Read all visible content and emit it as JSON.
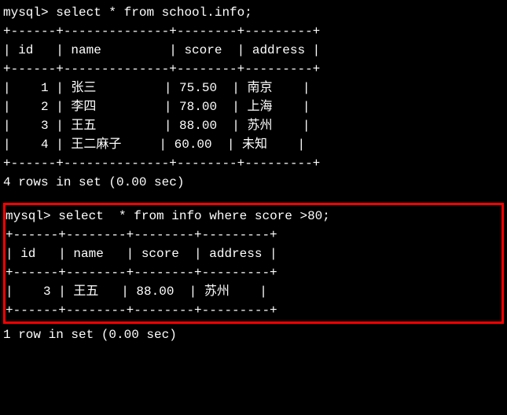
{
  "query1": {
    "prompt": "mysql> ",
    "sql": "select * from school.info;",
    "border_top": "+------+--------------+--------+---------+",
    "header_line": "| id   | name         | score  | address |",
    "border_mid": "+------+--------------+--------+---------+",
    "row1": "|    1 | 张三         | 75.50  | 南京    |",
    "row2": "|    2 | 李四         | 78.00  | 上海    |",
    "row3": "|    3 | 王五         | 88.00  | 苏州    |",
    "row4": "|    4 | 王二麻子     | 60.00  | 未知    |",
    "border_bot": "+------+--------------+--------+---------+",
    "status": "4 rows in set (0.00 sec)"
  },
  "query2": {
    "prompt": "mysql> ",
    "sql": "select  * from info where score >80;",
    "border_top": "+------+--------+--------+---------+",
    "header_line": "| id   | name   | score  | address |",
    "border_mid": "+------+--------+--------+---------+",
    "row1": "|    3 | 王五   | 88.00  | 苏州    |",
    "border_bot": "+------+--------+--------+---------+",
    "status": "1 row in set (0.00 sec)"
  },
  "chart_data": {
    "type": "table",
    "tables": [
      {
        "query": "select * from school.info;",
        "columns": [
          "id",
          "name",
          "score",
          "address"
        ],
        "rows": [
          {
            "id": 1,
            "name": "张三",
            "score": 75.5,
            "address": "南京"
          },
          {
            "id": 2,
            "name": "李四",
            "score": 78.0,
            "address": "上海"
          },
          {
            "id": 3,
            "name": "王五",
            "score": 88.0,
            "address": "苏州"
          },
          {
            "id": 4,
            "name": "王二麻子",
            "score": 60.0,
            "address": "未知"
          }
        ],
        "status": "4 rows in set (0.00 sec)"
      },
      {
        "query": "select  * from info where score >80;",
        "columns": [
          "id",
          "name",
          "score",
          "address"
        ],
        "rows": [
          {
            "id": 3,
            "name": "王五",
            "score": 88.0,
            "address": "苏州"
          }
        ],
        "status": "1 row in set (0.00 sec)"
      }
    ]
  }
}
